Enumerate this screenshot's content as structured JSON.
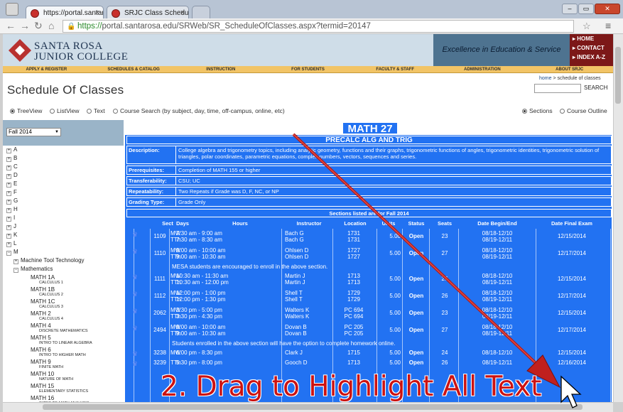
{
  "browser": {
    "tabs": [
      {
        "label": "https://portal.santarosa.e"
      },
      {
        "label": "SRJC Class Scheduler"
      }
    ],
    "url_scheme": "https://",
    "url_rest": "portal.santarosa.edu/SRWeb/SR_ScheduleOfClasses.aspx?termid=20147"
  },
  "site": {
    "brand_line1": "SANTA ROSA",
    "brand_line2": "JUNIOR COLLEGE",
    "tagline": "Excellence in Education & Service",
    "quick_links": [
      "HOME",
      "CONTACT",
      "INDEX A-Z"
    ],
    "nav": [
      "APPLY & REGISTER",
      "SCHEDULES & CATALOG",
      "INSTRUCTION",
      "FOR STUDENTS",
      "FACULTY & STAFF",
      "ADMINISTRATION",
      "ABOUT SRJC"
    ],
    "breadcrumb_home": "home",
    "breadcrumb_sep": ">",
    "breadcrumb_current": "schedule of classes",
    "search_label": "SEARCH"
  },
  "page": {
    "title": "Schedule Of Classes",
    "views": [
      "TreeView",
      "ListView",
      "Text",
      "Course Search (by subject, day, time, off-campus, online, etc)"
    ],
    "display": [
      "Sections",
      "Course Outline"
    ],
    "selected_view": "TreeView",
    "selected_display": "Sections",
    "term": "Fall 2014"
  },
  "tree": {
    "letters": [
      "A",
      "B",
      "C",
      "D",
      "E",
      "F",
      "G",
      "H",
      "I",
      "J",
      "K",
      "L",
      "M"
    ],
    "m_children": [
      "Machine Tool Technology",
      "Mathematics"
    ],
    "courses": [
      {
        "code": "MATH 1A",
        "name": "CALCULUS 1"
      },
      {
        "code": "MATH 1B",
        "name": "CALCULUS 2"
      },
      {
        "code": "MATH 1C",
        "name": "CALCULUS 3"
      },
      {
        "code": "MATH 2",
        "name": "CALCULUS 4"
      },
      {
        "code": "MATH 4",
        "name": "DISCRETE MATHEMATICS"
      },
      {
        "code": "MATH 5",
        "name": "INTRO TO LINEAR ALGEBRA"
      },
      {
        "code": "MATH 6",
        "name": "INTRO TO HIGHER MATH"
      },
      {
        "code": "MATH 9",
        "name": "FINITE MATH"
      },
      {
        "code": "MATH 10",
        "name": "NATURE OF MATH"
      },
      {
        "code": "MATH 15",
        "name": "ELEMENTARY STATISTICS"
      },
      {
        "code": "MATH 16",
        "name": "INTRO TO MATH ANALYSIS"
      }
    ]
  },
  "course": {
    "code": "MATH 27",
    "name": "PRECALC ALG AND TRIG",
    "fields": [
      {
        "key": "Description:",
        "value": "College algebra and trigonometry topics, including analytic geometry, functions and their graphs, trigonometric functions of angles, trigonometric identities, trigonometric solution of triangles, polar coordinates, parametric equations, complex numbers, vectors, sequences and series."
      },
      {
        "key": "Prerequisites:",
        "value": "Completion of MATH 155 or higher"
      },
      {
        "key": "Transferability:",
        "value": "CSU; UC"
      },
      {
        "key": "Repeatability:",
        "value": "Two Repeats if Grade was D, F, NC, or NP"
      },
      {
        "key": "Grading Type:",
        "value": "Grade Only"
      }
    ],
    "sections_title": "Sections listed are for Fall 2014",
    "columns": [
      "Sect",
      "Days",
      "Hours",
      "Instructor",
      "Location",
      "Units",
      "Status",
      "Seats",
      "Date Begin/End",
      "Date Final Exam"
    ],
    "sections": [
      {
        "sect": "1109",
        "days": [
          "MW",
          "TTh"
        ],
        "hours": [
          "7:30 am - 9:00 am",
          "7:30 am - 8:30 am"
        ],
        "instr": [
          "Bach G",
          "Bach G"
        ],
        "loc": [
          "1731",
          "1731"
        ],
        "units": "5.00",
        "status": "Open",
        "seats": "23",
        "dates": [
          "08/18-12/10",
          "08/19-12/11"
        ],
        "final": "12/15/2014"
      },
      {
        "sect": "1110",
        "days": [
          "MW",
          "TTh"
        ],
        "hours": [
          "9:00 am - 10:00 am",
          "9:00 am - 10:30 am"
        ],
        "instr": [
          "Ohlsen D",
          "Ohlsen D"
        ],
        "loc": [
          "1727",
          "1727"
        ],
        "units": "5.00",
        "status": "Open",
        "seats": "27",
        "dates": [
          "08/18-12/10",
          "08/19-12/11"
        ],
        "final": "12/17/2014"
      },
      {
        "sect": "1111",
        "days": [
          "MW",
          "TTh"
        ],
        "hours": [
          "10:30 am - 11:30 am",
          "10:30 am - 12:00 pm"
        ],
        "instr": [
          "Martin J",
          "Martin J"
        ],
        "loc": [
          "1713",
          "1713"
        ],
        "units": "5.00",
        "status": "Open",
        "seats": "26",
        "dates": [
          "08/18-12/10",
          "08/19-12/11"
        ],
        "final": "12/15/2014"
      },
      {
        "sect": "1112",
        "days": [
          "MW",
          "TTh"
        ],
        "hours": [
          "12:00 pm - 1:00 pm",
          "12:00 pm - 1:30 pm"
        ],
        "instr": [
          "Shell T",
          "Shell T"
        ],
        "loc": [
          "1729",
          "1729"
        ],
        "units": "5.00",
        "status": "Open",
        "seats": "26",
        "dates": [
          "08/18-12/10",
          "08/19-12/11"
        ],
        "final": "12/17/2014"
      },
      {
        "sect": "2062",
        "days": [
          "MW",
          "TTh"
        ],
        "hours": [
          "3:30 pm - 5:00 pm",
          "3:30 pm - 4:30 pm"
        ],
        "instr": [
          "Walters K",
          "Walters K"
        ],
        "loc": [
          "PC 694",
          "PC 694"
        ],
        "units": "5.00",
        "status": "Open",
        "seats": "23",
        "dates": [
          "08/18-12/10",
          "08/19-12/11"
        ],
        "final": "12/15/2014"
      },
      {
        "sect": "2494",
        "days": [
          "MW",
          "TTh"
        ],
        "hours": [
          "9:00 am - 10:00 am",
          "9:00 am - 10:30 am"
        ],
        "instr": [
          "Dovan B",
          "Dovan B"
        ],
        "loc": [
          "PC 205",
          "PC 205"
        ],
        "units": "5.00",
        "status": "Open",
        "seats": "27",
        "dates": [
          "08/18-12/10",
          "08/19-12/11"
        ],
        "final": "12/17/2014"
      },
      {
        "sect": "3238",
        "days": [
          "MW",
          ""
        ],
        "hours": [
          "6:00 pm - 8:30 pm",
          ""
        ],
        "instr": [
          "Clark J",
          ""
        ],
        "loc": [
          "1715",
          ""
        ],
        "units": "5.00",
        "status": "Open",
        "seats": "24",
        "dates": [
          "08/18-12/10",
          ""
        ],
        "final": "12/15/2014"
      },
      {
        "sect": "3239",
        "days": [
          "TTh",
          ""
        ],
        "hours": [
          "5:30 pm - 8:00 pm",
          ""
        ],
        "instr": [
          "Gooch D",
          ""
        ],
        "loc": [
          "1713",
          ""
        ],
        "units": "5.00",
        "status": "Open",
        "seats": "26",
        "dates": [
          "08/19-12/11",
          ""
        ],
        "final": "12/16/2014"
      }
    ],
    "notes": {
      "after_1110": "MESA students are encouraged to enroll in the above section.",
      "after_2494": "Students enrolled in the above section will have the option to complete homework online."
    }
  },
  "overlay": {
    "caption": "2. Drag to Highlight All Text",
    "arrow_color": "#c0201e"
  }
}
